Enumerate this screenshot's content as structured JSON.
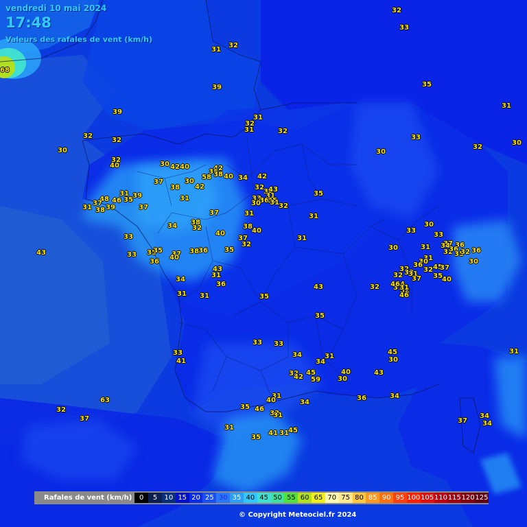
{
  "header": {
    "date": "vendredi 10 mai 2024",
    "time": "17:48",
    "subtitle": "Valeurs des rafales de vent (km/h)"
  },
  "legend": {
    "title": "Rafales de vent (km/h)",
    "items": [
      {
        "label": "0",
        "color": "#000000",
        "text": "#ffffff"
      },
      {
        "label": "5",
        "color": "#0a1e50",
        "text": "#ffffff"
      },
      {
        "label": "10",
        "color": "#0a2f7a",
        "text": "#ffffff"
      },
      {
        "label": "15",
        "color": "#0010c8",
        "text": "#ffffff"
      },
      {
        "label": "20",
        "color": "#0a2be8",
        "text": "#ffffff"
      },
      {
        "label": "25",
        "color": "#1a50f2",
        "text": "#ffffff"
      },
      {
        "label": "30",
        "color": "#2a78f5",
        "text": "#1a2bff"
      },
      {
        "label": "35",
        "color": "#2aa0f8",
        "text": "#ffffff"
      },
      {
        "label": "40",
        "color": "#30c8ff",
        "text": "#000000"
      },
      {
        "label": "45",
        "color": "#40e0d0",
        "text": "#000000"
      },
      {
        "label": "50",
        "color": "#40e0a0",
        "text": "#000000"
      },
      {
        "label": "55",
        "color": "#50e040",
        "text": "#000000"
      },
      {
        "label": "60",
        "color": "#b0e020",
        "text": "#000000"
      },
      {
        "label": "65",
        "color": "#f0f020",
        "text": "#000000"
      },
      {
        "label": "70",
        "color": "#fff8b0",
        "text": "#000000"
      },
      {
        "label": "75",
        "color": "#ffe890",
        "text": "#000000"
      },
      {
        "label": "80",
        "color": "#ffc840",
        "text": "#000000"
      },
      {
        "label": "85",
        "color": "#ff9820",
        "text": "#ffffff"
      },
      {
        "label": "90",
        "color": "#ff7010",
        "text": "#ffffff"
      },
      {
        "label": "95",
        "color": "#ff4010",
        "text": "#ffffff"
      },
      {
        "label": "100",
        "color": "#ff2000",
        "text": "#ffffff"
      },
      {
        "label": "105",
        "color": "#e01010",
        "text": "#ffffff"
      },
      {
        "label": "110",
        "color": "#c00010",
        "text": "#ffffff"
      },
      {
        "label": "115",
        "color": "#a00010",
        "text": "#ffffff"
      },
      {
        "label": "120",
        "color": "#800010",
        "text": "#ffffff"
      },
      {
        "label": "125",
        "color": "#600010",
        "text": "#ffffff"
      }
    ]
  },
  "copyright": "© Copyright Meteociel.fr 2024",
  "values": [
    {
      "v": "68"
    },
    {
      "v": "32"
    },
    {
      "v": "33"
    },
    {
      "v": "31"
    },
    {
      "v": "32"
    },
    {
      "v": "39"
    },
    {
      "v": "35"
    },
    {
      "v": "39"
    },
    {
      "v": "31"
    },
    {
      "v": "32"
    },
    {
      "v": "31"
    },
    {
      "v": "32"
    },
    {
      "v": "32"
    },
    {
      "v": "32"
    },
    {
      "v": "31"
    },
    {
      "v": "30"
    },
    {
      "v": "33"
    },
    {
      "v": "32"
    },
    {
      "v": "30"
    },
    {
      "v": "30"
    },
    {
      "v": "32"
    },
    {
      "v": "40"
    },
    {
      "v": "30"
    },
    {
      "v": "42"
    },
    {
      "v": "40"
    },
    {
      "v": "42"
    },
    {
      "v": "36"
    },
    {
      "v": "58"
    },
    {
      "v": "38"
    },
    {
      "v": "40"
    },
    {
      "v": "34"
    },
    {
      "v": "42"
    },
    {
      "v": "37"
    },
    {
      "v": "38"
    },
    {
      "v": "30"
    },
    {
      "v": "42"
    },
    {
      "v": "32"
    },
    {
      "v": "34"
    },
    {
      "v": "43"
    },
    {
      "v": "35"
    },
    {
      "v": "31"
    },
    {
      "v": "31"
    },
    {
      "v": "39"
    },
    {
      "v": "48"
    },
    {
      "v": "46"
    },
    {
      "v": "37"
    },
    {
      "v": "31"
    },
    {
      "v": "35"
    },
    {
      "v": "39"
    },
    {
      "v": "38"
    },
    {
      "v": "31"
    },
    {
      "v": "33"
    },
    {
      "v": "36"
    },
    {
      "v": "35"
    },
    {
      "v": "30"
    },
    {
      "v": "32"
    },
    {
      "v": "31"
    },
    {
      "v": "37"
    },
    {
      "v": "37"
    },
    {
      "v": "31"
    },
    {
      "v": "38"
    },
    {
      "v": "34"
    },
    {
      "v": "32"
    },
    {
      "v": "40"
    },
    {
      "v": "38"
    },
    {
      "v": "40"
    },
    {
      "v": "31"
    },
    {
      "v": "30"
    },
    {
      "v": "33"
    },
    {
      "v": "33"
    },
    {
      "v": "33"
    },
    {
      "v": "35"
    },
    {
      "v": "37"
    },
    {
      "v": "32"
    },
    {
      "v": "43"
    },
    {
      "v": "33"
    },
    {
      "v": "35"
    },
    {
      "v": "36"
    },
    {
      "v": "37"
    },
    {
      "v": "40"
    },
    {
      "v": "38"
    },
    {
      "v": "36"
    },
    {
      "v": "35"
    },
    {
      "v": "31"
    },
    {
      "v": "30"
    },
    {
      "v": "37"
    },
    {
      "v": "36"
    },
    {
      "v": "31"
    },
    {
      "v": "32"
    },
    {
      "v": "34"
    },
    {
      "v": "36"
    },
    {
      "v": "35"
    },
    {
      "v": "36"
    },
    {
      "v": "31"
    },
    {
      "v": "32"
    },
    {
      "v": "30"
    },
    {
      "v": "36"
    },
    {
      "v": "32"
    },
    {
      "v": "33"
    },
    {
      "v": "32"
    },
    {
      "v": "45"
    },
    {
      "v": "37"
    },
    {
      "v": "35"
    },
    {
      "v": "40"
    },
    {
      "v": "30"
    },
    {
      "v": "43"
    },
    {
      "v": "31"
    },
    {
      "v": "34"
    },
    {
      "v": "36"
    },
    {
      "v": "34"
    },
    {
      "v": "31"
    },
    {
      "v": "32"
    },
    {
      "v": "32"
    },
    {
      "v": "37"
    },
    {
      "v": "31"
    },
    {
      "v": "31"
    },
    {
      "v": "46"
    },
    {
      "v": "31"
    },
    {
      "v": "46"
    },
    {
      "v": "43"
    },
    {
      "v": "32"
    },
    {
      "v": "31"
    },
    {
      "v": "35"
    },
    {
      "v": "35"
    },
    {
      "v": "33"
    },
    {
      "v": "33"
    },
    {
      "v": "33"
    },
    {
      "v": "41"
    },
    {
      "v": "34"
    },
    {
      "v": "31"
    },
    {
      "v": "34"
    },
    {
      "v": "45"
    },
    {
      "v": "30"
    },
    {
      "v": "31"
    },
    {
      "v": "32"
    },
    {
      "v": "42"
    },
    {
      "v": "45"
    },
    {
      "v": "59"
    },
    {
      "v": "40"
    },
    {
      "v": "30"
    },
    {
      "v": "43"
    },
    {
      "v": "31"
    },
    {
      "v": "36"
    },
    {
      "v": "34"
    },
    {
      "v": "63"
    },
    {
      "v": "40"
    },
    {
      "v": "34"
    },
    {
      "v": "35"
    },
    {
      "v": "46"
    },
    {
      "v": "32"
    },
    {
      "v": "32"
    },
    {
      "v": "31"
    },
    {
      "v": "37"
    },
    {
      "v": "37"
    },
    {
      "v": "34"
    },
    {
      "v": "34"
    },
    {
      "v": "31"
    },
    {
      "v": "41"
    },
    {
      "v": "31"
    },
    {
      "v": "45"
    },
    {
      "v": "35"
    }
  ]
}
